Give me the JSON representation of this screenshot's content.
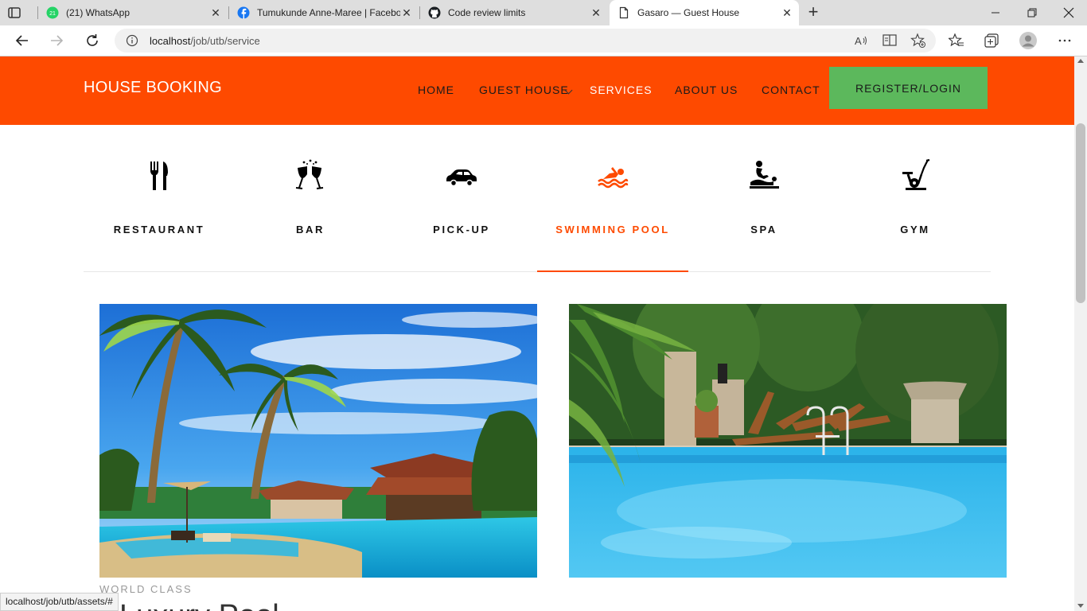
{
  "browser": {
    "tabs": [
      {
        "title": "(21) WhatsApp",
        "icon": "whatsapp-icon",
        "badge": "21"
      },
      {
        "title": "Tumukunde Anne-Maree | Facebook",
        "icon": "facebook-icon"
      },
      {
        "title": "Code review limits",
        "icon": "github-icon"
      },
      {
        "title": "Gasaro — Guest House",
        "icon": "page-icon",
        "active": true
      }
    ],
    "url_host": "localhost",
    "url_path": "/job/utb/service",
    "status_url": "localhost/job/utb/assets/#"
  },
  "site": {
    "brand": "HOUSE BOOKING",
    "nav": [
      "HOME",
      "GUEST HOUSE",
      "SERVICES",
      "ABOUT US",
      "CONTACT"
    ],
    "active_nav": "SERVICES",
    "register_label": "REGISTER/LOGIN",
    "colors": {
      "brand_orange": "#fe4a00",
      "button_green": "#5cb85c"
    }
  },
  "services": [
    {
      "label": "RESTAURANT",
      "icon": "fork-knife-icon"
    },
    {
      "label": "BAR",
      "icon": "wine-glasses-icon"
    },
    {
      "label": "PICK-UP",
      "icon": "car-icon"
    },
    {
      "label": "SWIMMING POOL",
      "icon": "swimmer-icon",
      "active": true
    },
    {
      "label": "SPA",
      "icon": "massage-icon"
    },
    {
      "label": "GYM",
      "icon": "exercise-bike-icon"
    }
  ],
  "content": {
    "eyebrow": "WORLD CLASS",
    "title": "Luxury Pool"
  }
}
